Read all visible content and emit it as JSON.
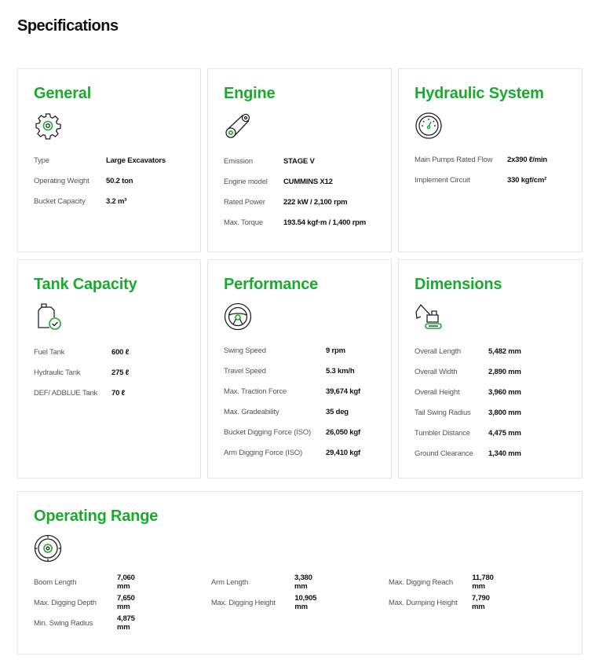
{
  "page": {
    "title": "Specifications"
  },
  "general": {
    "title": "General",
    "icon": "gear-icon",
    "rows": [
      {
        "label": "Type",
        "value": "Large Excavators"
      },
      {
        "label": "Operating Weight",
        "value": "50.2  ton"
      },
      {
        "label": "Bucket Capacity",
        "value": "3.2  m³"
      }
    ]
  },
  "engine": {
    "title": "Engine",
    "icon": "engine-belt-icon",
    "rows": [
      {
        "label": "Emission",
        "value": "STAGE V"
      },
      {
        "label": "Engine model",
        "value": "CUMMINS X12"
      },
      {
        "label": "Rated Power",
        "value": "222  kW / 2,100 rpm"
      },
      {
        "label": "Max. Torque",
        "value": "193.54  kgf·m / 1,400 rpm"
      }
    ]
  },
  "hydraulic": {
    "title": "Hydraulic System",
    "icon": "gauge-icon",
    "rows": [
      {
        "label": "Main Pumps Rated Flow",
        "value": "2x390  ℓ/min"
      },
      {
        "label": "Implement Circuit",
        "value": "330  kgf/cm²"
      }
    ]
  },
  "tank": {
    "title": "Tank Capacity",
    "icon": "fuel-can-icon",
    "rows": [
      {
        "label": "Fuel Tank",
        "value": "600  ℓ"
      },
      {
        "label": "Hydraulic Tank",
        "value": "275  ℓ"
      },
      {
        "label": "DEF/ ADBLUE Tank",
        "value": "70  ℓ"
      }
    ]
  },
  "performance": {
    "title": "Performance",
    "icon": "steering-wheel-icon",
    "rows": [
      {
        "label": "Swing Speed",
        "value": "9  rpm"
      },
      {
        "label": "Travel Speed",
        "value": "5.3  km/h"
      },
      {
        "label": "Max. Traction Force",
        "value": "39,674  kgf"
      },
      {
        "label": "Max. Gradeability",
        "value": "35  deg"
      },
      {
        "label": "Bucket Digging Force (ISO)",
        "value": "26,050  kgf"
      },
      {
        "label": "Arm Digging Force (ISO)",
        "value": "29,410  kgf"
      }
    ]
  },
  "dimensions": {
    "title": "Dimensions",
    "icon": "excavator-icon",
    "rows": [
      {
        "label": "Overall Length",
        "value": "5,482  mm"
      },
      {
        "label": "Overall Width",
        "value": "2,890  mm"
      },
      {
        "label": "Overall Height",
        "value": "3,960  mm"
      },
      {
        "label": "Tail Swing Radius",
        "value": "3,800  mm"
      },
      {
        "label": "Tumbler Distance",
        "value": "4,475  mm"
      },
      {
        "label": "Ground Clearance",
        "value": "1,340  mm"
      }
    ]
  },
  "range": {
    "title": "Operating Range",
    "icon": "target-icon",
    "rows": [
      {
        "label": "Boom Length",
        "value": "7,060  mm"
      },
      {
        "label": "Arm Length",
        "value": "3,380  mm"
      },
      {
        "label": "Max. Digging Reach",
        "value": "11,780  mm"
      },
      {
        "label": "Max. Digging Depth",
        "value": "7,650  mm"
      },
      {
        "label": "Max. Digging Height",
        "value": "10,905  mm"
      },
      {
        "label": "Max. Dumping Height",
        "value": "7,790  mm"
      },
      {
        "label": "Min. Swing Radius",
        "value": "4,875  mm"
      }
    ]
  },
  "colors": {
    "accent": "#1aab2e",
    "border": "#e6e6e6",
    "text": "#111111",
    "label": "#555555"
  }
}
